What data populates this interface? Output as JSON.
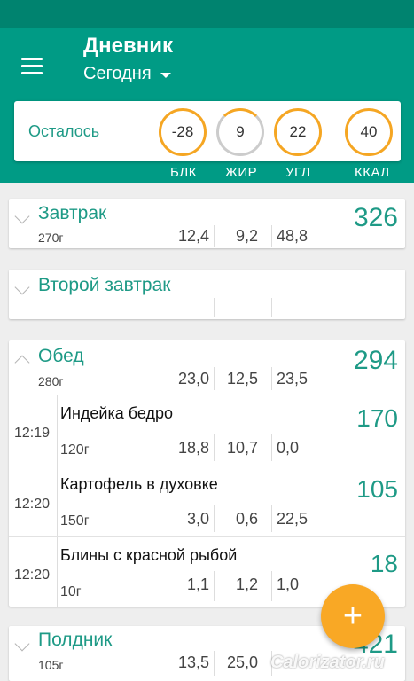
{
  "header": {
    "title": "Дневник",
    "day": "Сегодня"
  },
  "summary": {
    "label": "Осталось",
    "values": {
      "protein": "-28",
      "fat": "9",
      "carbs": "22",
      "kcal": "40"
    },
    "labels": {
      "protein": "БЛК",
      "fat": "ЖИР",
      "carbs": "УГЛ",
      "kcal": "ККАЛ"
    }
  },
  "meals": {
    "breakfast": {
      "name": "Завтрак",
      "kcal": "326",
      "weight": "270г",
      "protein": "12,4",
      "fat": "9,2",
      "carbs": "48,8"
    },
    "second_breakfast": {
      "name": "Второй завтрак"
    },
    "lunch": {
      "name": "Обед",
      "kcal": "294",
      "weight": "280г",
      "protein": "23,0",
      "fat": "12,5",
      "carbs": "23,5",
      "items": [
        {
          "time": "12:19",
          "name": "Индейка бедро",
          "weight": "120г",
          "protein": "18,8",
          "fat": "10,7",
          "carbs": "0,0",
          "kcal": "170"
        },
        {
          "time": "12:20",
          "name": "Картофель в духовке",
          "weight": "150г",
          "protein": "3,0",
          "fat": "0,6",
          "carbs": "22,5",
          "kcal": "105"
        },
        {
          "time": "12:20",
          "name": "Блины с красной рыбой",
          "weight": "10г",
          "protein": "1,1",
          "fat": "1,2",
          "carbs": "1,0",
          "kcal": "18"
        }
      ]
    },
    "snack": {
      "name": "Полдник",
      "kcal": "421",
      "weight": "105г",
      "protein": "13,5",
      "fat": "25,0",
      "carbs": ""
    }
  },
  "fab": {
    "label": "+"
  },
  "watermark": "Calorizator.ru"
}
